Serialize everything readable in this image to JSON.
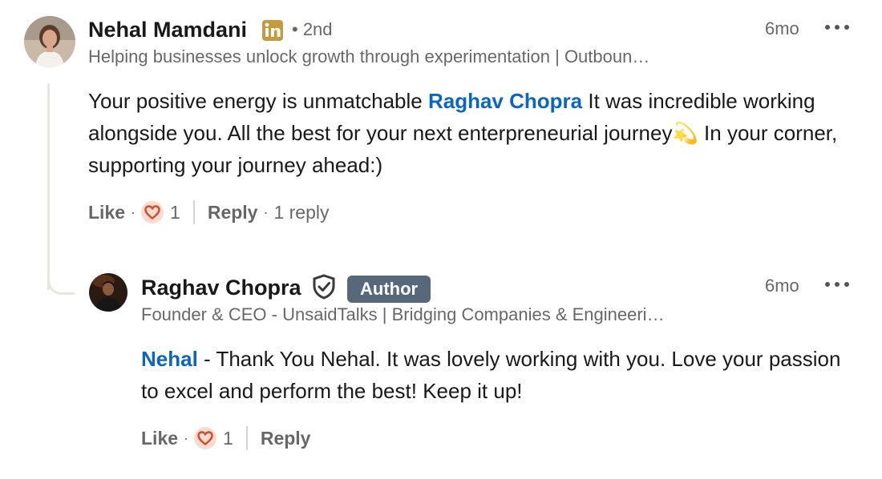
{
  "comment": {
    "author_name": "Nehal Mamdani",
    "connection": "• 2nd",
    "headline": "Helping businesses unlock growth through experimentation | Outboun…",
    "time": "6mo",
    "text_part1": "Your positive energy is unmatchable ",
    "mention": "Raghav Chopra",
    "text_part2": " It was incredible working alongside you. All the best for your next enterpreneurial journey💫 In your corner, supporting your journey ahead:)",
    "like_label": "Like",
    "reaction_count": "1",
    "reply_label": "Reply",
    "replies_count": "1 reply"
  },
  "reply": {
    "author_name": "Raghav Chopra",
    "author_badge": "Author",
    "headline": "Founder & CEO - UnsaidTalks | Bridging Companies & Engineeri…",
    "time": "6mo",
    "mention": "Nehal",
    "text": " - Thank You Nehal. It was lovely working with you. Love your passion to excel and perform the best! Keep it up!",
    "like_label": "Like",
    "reaction_count": "1",
    "reply_label": "Reply"
  },
  "icons": {
    "linkedin_badge": "linkedin-premium-icon",
    "verified": "verified-shield-icon",
    "reaction": "heart-reaction-icon",
    "more": "more-options-icon"
  },
  "colors": {
    "mention": "#0a66c2",
    "author_badge_bg": "#56687a",
    "premium_gold": "#c49a3a",
    "reaction_bg": "#f8dccf",
    "reaction_heart": "#d6492e"
  }
}
